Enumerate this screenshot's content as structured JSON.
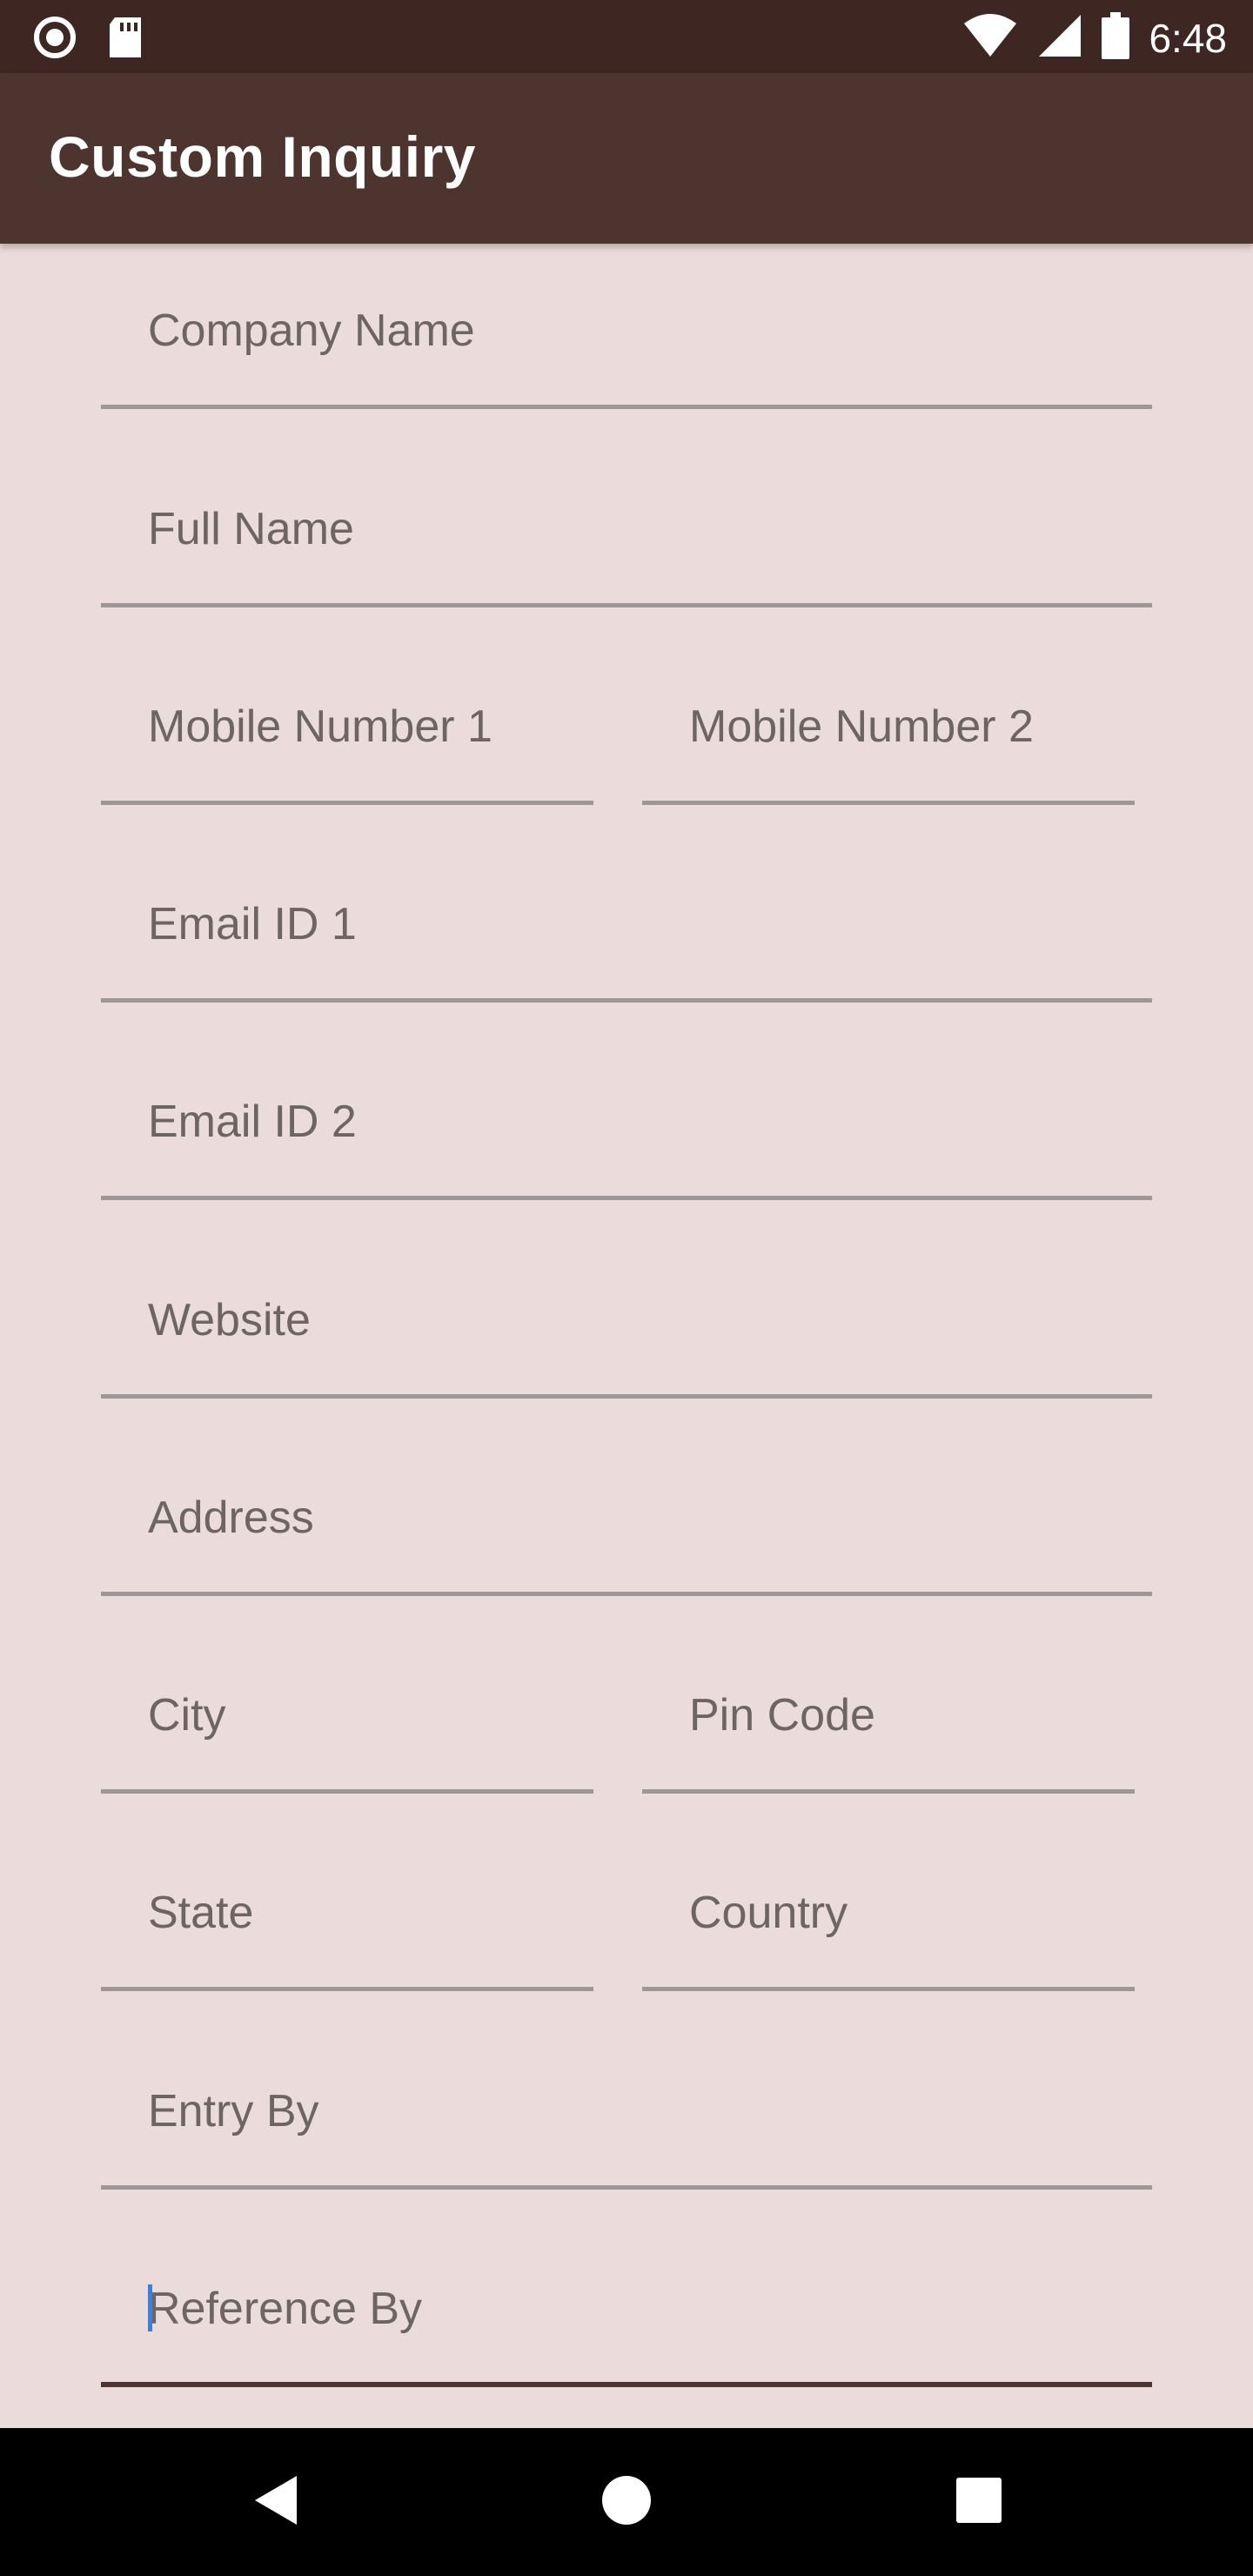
{
  "status_bar": {
    "time": "6:48",
    "icons": [
      "record-icon",
      "sd-card-icon",
      "wifi-icon",
      "signal-icon",
      "battery-icon"
    ]
  },
  "app_bar": {
    "title": "Custom Inquiry"
  },
  "form": {
    "company_name": {
      "placeholder": "Company Name"
    },
    "full_name": {
      "placeholder": "Full Name"
    },
    "mobile_1": {
      "placeholder": "Mobile Number 1"
    },
    "mobile_2": {
      "placeholder": "Mobile Number 2"
    },
    "email_1": {
      "placeholder": "Email ID 1"
    },
    "email_2": {
      "placeholder": "Email ID 2"
    },
    "website": {
      "placeholder": "Website"
    },
    "address": {
      "placeholder": "Address"
    },
    "city": {
      "placeholder": "City"
    },
    "pin_code": {
      "placeholder": "Pin Code"
    },
    "state": {
      "placeholder": "State"
    },
    "country": {
      "placeholder": "Country"
    },
    "entry_by": {
      "placeholder": "Entry By"
    },
    "reference_by": {
      "placeholder": "Reference By",
      "focused": true
    }
  },
  "nav_bar": {
    "icons": [
      "back-icon",
      "home-icon",
      "recents-icon"
    ]
  },
  "colors": {
    "status_bar": "#3e2723",
    "app_bar": "#4e342e",
    "background": "#ecdbdb",
    "underline": "#9e9797",
    "focused_underline": "#4e342e",
    "cursor": "#3f7fdc"
  }
}
